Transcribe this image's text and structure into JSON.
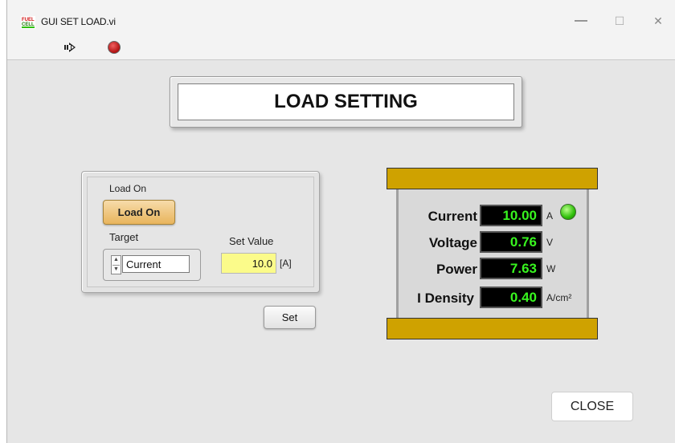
{
  "window": {
    "title": "GUI SET LOAD.vi",
    "minimize_glyph": "—",
    "maximize_glyph": "☐",
    "close_glyph": "✕"
  },
  "toolbar": {
    "run_icon": "run-arrow-icon",
    "stop_icon": "abort-stop-icon"
  },
  "panel_title": "LOAD SETTING",
  "controls": {
    "load_on_label": "Load On",
    "load_on_button": "Load On",
    "target_label": "Target",
    "target_value": "Current",
    "set_value_label": "Set Value",
    "set_value": "10.0",
    "set_value_unit": "[A]",
    "set_button": "Set"
  },
  "meter": {
    "plate_color": "#cfa200",
    "value_color": "#38f51f",
    "led_color": "#2fbf0a",
    "readouts": [
      {
        "label": "Current",
        "value": "10.00",
        "unit": "A"
      },
      {
        "label": "Voltage",
        "value": "0.76",
        "unit": "V"
      },
      {
        "label": "Power",
        "value": "7.63",
        "unit": "W"
      },
      {
        "label": "I Density",
        "value": "0.40",
        "unit": "A/cm²"
      }
    ]
  },
  "close_button": "CLOSE"
}
